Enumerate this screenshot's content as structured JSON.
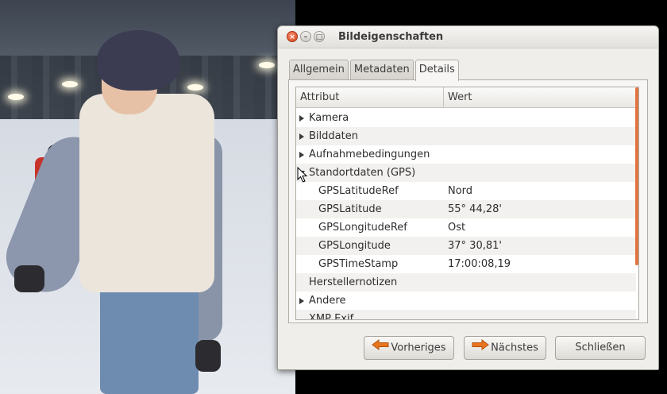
{
  "window": {
    "title": "Bildeigenschaften",
    "close_glyph": "×",
    "min_glyph": "–",
    "max_glyph": "□"
  },
  "tabs": [
    {
      "label": "Allgemein",
      "active": false
    },
    {
      "label": "Metadaten",
      "active": false
    },
    {
      "label": "Details",
      "active": true
    }
  ],
  "table": {
    "headers": {
      "attribute": "Attribut",
      "value": "Wert"
    },
    "rows": [
      {
        "attribute": "Kamera",
        "value": "",
        "expander": "collapsed"
      },
      {
        "attribute": "Bilddaten",
        "value": "",
        "expander": "collapsed"
      },
      {
        "attribute": "Aufnahmebedingungen",
        "value": "",
        "expander": "collapsed"
      },
      {
        "attribute": "Standortdaten (GPS)",
        "value": "",
        "expander": "expanded"
      },
      {
        "attribute": "GPSLatitudeRef",
        "value": "Nord",
        "expander": "none"
      },
      {
        "attribute": "GPSLatitude",
        "value": "55° 44,28'",
        "expander": "none"
      },
      {
        "attribute": "GPSLongitudeRef",
        "value": "Ost",
        "expander": "none"
      },
      {
        "attribute": "GPSLongitude",
        "value": "37° 30,81'",
        "expander": "none"
      },
      {
        "attribute": "GPSTimeStamp",
        "value": "17:00:08,19",
        "expander": "none"
      },
      {
        "attribute": "Herstellernotizen",
        "value": "",
        "expander": "none"
      },
      {
        "attribute": "Andere",
        "value": "",
        "expander": "collapsed"
      },
      {
        "attribute": "XMP Exif",
        "value": "",
        "expander": "none"
      }
    ]
  },
  "buttons": {
    "previous": "Vorheriges",
    "next": "Nächstes",
    "close": "Schließen"
  },
  "colors": {
    "accent_scroll": "#e2743f",
    "arrow_orange": "#e8741f",
    "close_button": "#d9441c"
  },
  "icons": {
    "previous": "arrow-left-icon",
    "next": "arrow-right-icon"
  }
}
